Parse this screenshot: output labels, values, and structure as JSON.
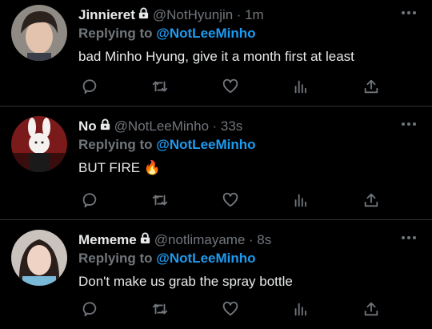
{
  "tweets": [
    {
      "display_name": "Jinnieret",
      "handle": "@NotHyunjin",
      "time": "· 1m",
      "replying_label": "Replying to ",
      "replying_to": "@NotLeeMinho",
      "text": "bad Minho Hyung, give it a month first at least"
    },
    {
      "display_name": "No",
      "handle": "@NotLeeMinho",
      "time": "· 33s",
      "replying_label": "Replying to ",
      "replying_to": "@NotLeeMinho",
      "text": "BUT FIRE 🔥"
    },
    {
      "display_name": "Mememe",
      "handle": "@notlimayame",
      "time": "· 8s",
      "replying_label": "Replying to ",
      "replying_to": "@NotLeeMinho",
      "text": "Don't make us grab the spray bottle"
    }
  ],
  "icons": {
    "lock": "lock-icon",
    "more": "more-icon",
    "reply": "reply-icon",
    "retweet": "retweet-icon",
    "like": "like-icon",
    "analytics": "analytics-icon",
    "share": "share-icon"
  },
  "colors": {
    "background": "#000000",
    "text": "#e7e9ea",
    "muted": "#71767b",
    "accent": "#1d9bf0",
    "divider": "#2f3336"
  }
}
